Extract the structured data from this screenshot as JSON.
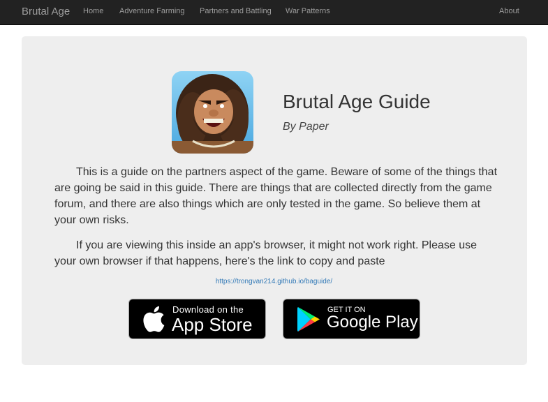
{
  "navbar": {
    "brand": "Brutal Age",
    "links": [
      "Home",
      "Adventure Farming",
      "Partners and Battling",
      "War Patterns"
    ],
    "right_link": "About"
  },
  "header": {
    "logo_icon": "brutal-age-game-icon",
    "title": "Brutal Age Guide",
    "byline": "By Paper"
  },
  "body": {
    "paragraph1": "This is a guide on the partners aspect of the game. Beware of some of the things that are going be said in this guide. There are things that are collected directly from the game forum, and there are also things which are only tested in the game. So believe them at your own risks.",
    "paragraph2": "If you are viewing this inside an app's browser, it might not work right. Please use your own browser if that happens, here's the link to copy and paste",
    "link": "https://trongvan214.github.io/baguide/"
  },
  "store_badges": {
    "appstore": {
      "icon": "apple-icon",
      "small": "Download on the",
      "big": "App Store"
    },
    "googleplay": {
      "icon": "google-play-icon",
      "small": "GET IT ON",
      "big": "Google Play"
    }
  },
  "colors": {
    "navbar_bg": "#222222",
    "nav_text": "#9d9d9d",
    "panel_bg": "#eeeeee",
    "link": "#337ab7"
  }
}
